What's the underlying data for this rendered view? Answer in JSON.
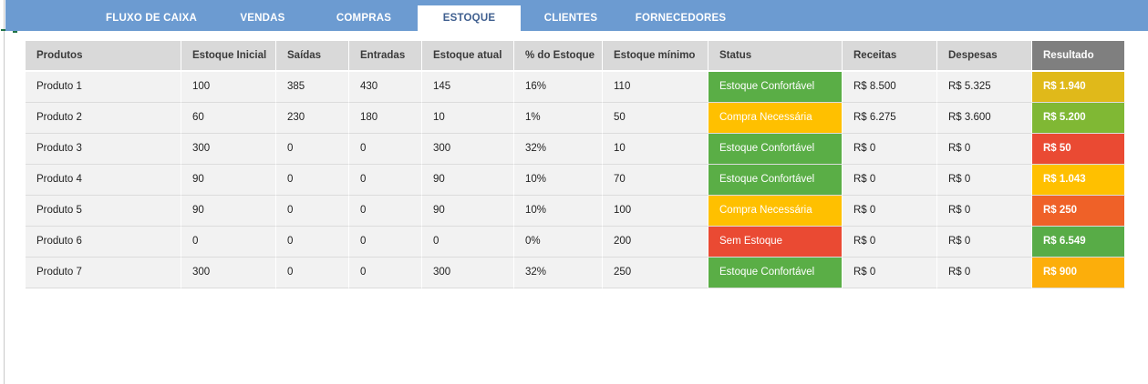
{
  "nav": {
    "tabs": [
      {
        "label": "FLUXO DE CAIXA",
        "active": false
      },
      {
        "label": "VENDAS",
        "active": false
      },
      {
        "label": "COMPRAS",
        "active": false
      },
      {
        "label": "ESTOQUE",
        "active": true
      },
      {
        "label": "CLIENTES",
        "active": false
      },
      {
        "label": "FORNECEDORES",
        "active": false
      }
    ]
  },
  "table": {
    "headers": [
      "Produtos",
      "Estoque Inicial",
      "Saídas",
      "Entradas",
      "Estoque atual",
      "% do Estoque",
      "Estoque mínimo",
      "Status",
      "Receitas",
      "Despesas",
      "Resultado"
    ],
    "rows": [
      {
        "produto": "Produto 1",
        "inicial": "100",
        "saidas": "385",
        "entradas": "430",
        "atual": "145",
        "pct": "16%",
        "minimo": "110",
        "status": "Estoque Confortável",
        "status_color": "#5aae46",
        "receitas": "R$ 8.500",
        "despesas": "R$ 5.325",
        "resultado": "R$ 1.940",
        "resultado_color": "#e0b91a"
      },
      {
        "produto": "Produto 2",
        "inicial": "60",
        "saidas": "230",
        "entradas": "180",
        "atual": "10",
        "pct": "1%",
        "minimo": "50",
        "status": "Compra Necessária",
        "status_color": "#ffc000",
        "receitas": "R$ 6.275",
        "despesas": "R$ 3.600",
        "resultado": "R$ 5.200",
        "resultado_color": "#80b834"
      },
      {
        "produto": "Produto 3",
        "inicial": "300",
        "saidas": "0",
        "entradas": "0",
        "atual": "300",
        "pct": "32%",
        "minimo": "10",
        "status": "Estoque Confortável",
        "status_color": "#5aae46",
        "receitas": "R$ 0",
        "despesas": "R$ 0",
        "resultado": "R$ 50",
        "resultado_color": "#ea4a33"
      },
      {
        "produto": "Produto 4",
        "inicial": "90",
        "saidas": "0",
        "entradas": "0",
        "atual": "90",
        "pct": "10%",
        "minimo": "70",
        "status": "Estoque Confortável",
        "status_color": "#5aae46",
        "receitas": "R$ 0",
        "despesas": "R$ 0",
        "resultado": "R$ 1.043",
        "resultado_color": "#ffc000"
      },
      {
        "produto": "Produto 5",
        "inicial": "90",
        "saidas": "0",
        "entradas": "0",
        "atual": "90",
        "pct": "10%",
        "minimo": "100",
        "status": "Compra Necessária",
        "status_color": "#ffc000",
        "receitas": "R$ 0",
        "despesas": "R$ 0",
        "resultado": "R$ 250",
        "resultado_color": "#ef6128"
      },
      {
        "produto": "Produto 6",
        "inicial": "0",
        "saidas": "0",
        "entradas": "0",
        "atual": "0",
        "pct": "0%",
        "minimo": "200",
        "status": "Sem Estoque",
        "status_color": "#ea4a33",
        "receitas": "R$ 0",
        "despesas": "R$ 0",
        "resultado": "R$ 6.549",
        "resultado_color": "#58ac47"
      },
      {
        "produto": "Produto 7",
        "inicial": "300",
        "saidas": "0",
        "entradas": "0",
        "atual": "300",
        "pct": "32%",
        "minimo": "250",
        "status": "Estoque Confortável",
        "status_color": "#5aae46",
        "receitas": "R$ 0",
        "despesas": "R$ 0",
        "resultado": "R$ 900",
        "resultado_color": "#fcae0b"
      }
    ]
  }
}
